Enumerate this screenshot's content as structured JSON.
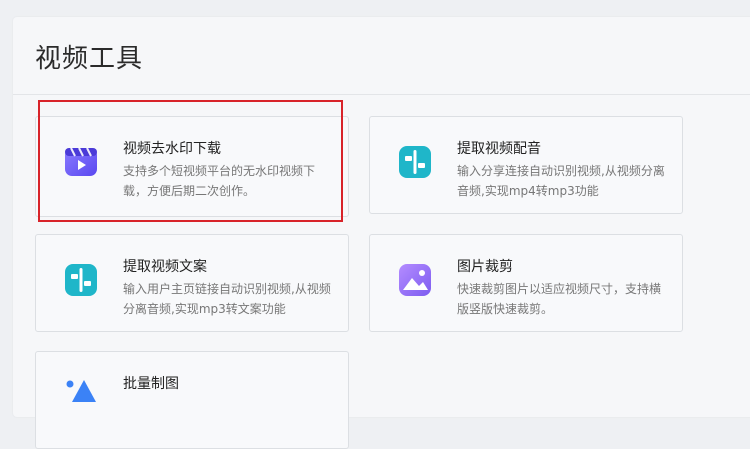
{
  "page": {
    "title": "视频工具"
  },
  "tools": [
    {
      "title": "视频去水印下载",
      "desc": "支持多个短视频平台的无水印视频下载，方便后期二次创作。",
      "icon": "clapperboard-icon"
    },
    {
      "title": "提取视频配音",
      "desc": "输入分享连接自动识别视频,从视频分离音频,实现mp4转mp3功能",
      "icon": "split-icon"
    },
    {
      "title": "提取视频文案",
      "desc": "输入用户主页链接自动识别视频,从视频分离音频,实现mp3转文案功能",
      "icon": "split-icon"
    },
    {
      "title": "图片裁剪",
      "desc": "快速裁剪图片以适应视频尺寸，支持横版竖版快速裁剪。",
      "icon": "image-icon"
    },
    {
      "title": "批量制图",
      "desc": "",
      "icon": "shapes-icon"
    }
  ],
  "colors": {
    "highlight": "#d8232a",
    "purple": "#6b5cf6",
    "teal": "#1fb6c9",
    "violet": "#9b6cf0",
    "blue": "#3b82f6"
  }
}
